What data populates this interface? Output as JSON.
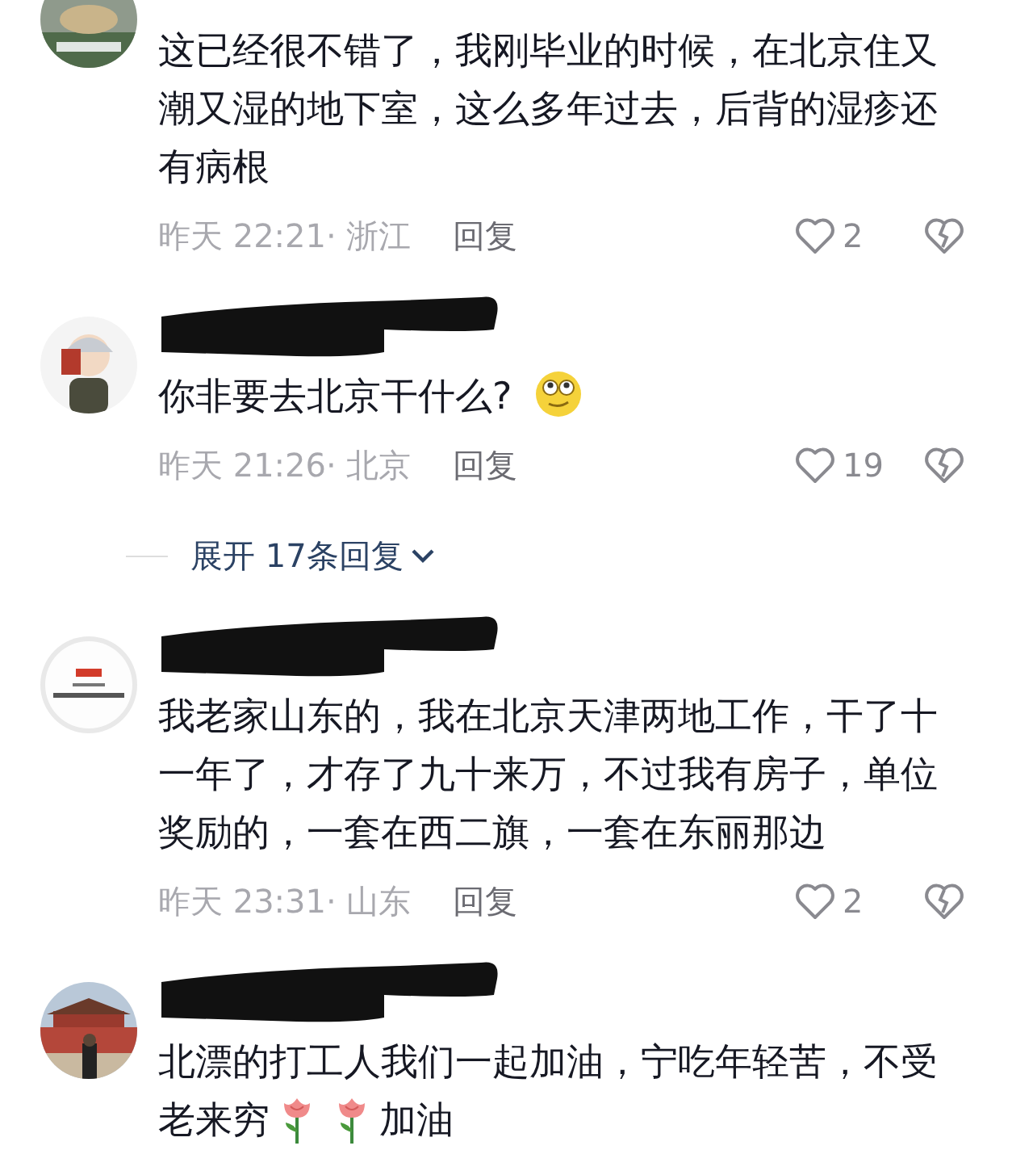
{
  "comments": [
    {
      "avatar": {
        "kind": "picture"
      },
      "redacted": false,
      "body": [
        {
          "kind": "text",
          "text": "这已经很不错了，我刚毕业的时候，在北京住又潮又湿的地下室，这么多年过去，后背的湿疹还有病根"
        }
      ],
      "meta": "昨天 22:21· 浙江",
      "reply": "回复",
      "likes": "2"
    },
    {
      "avatar": {
        "kind": "picture"
      },
      "redacted": true,
      "body": [
        {
          "kind": "text",
          "text": "你非要去北京干什么?"
        },
        {
          "kind": "emoji"
        }
      ],
      "meta": "昨天 21:26· 北京",
      "reply": "回复",
      "likes": "19",
      "replies_toggle": "展开 17条回复"
    },
    {
      "avatar": {
        "kind": "picture"
      },
      "redacted": true,
      "body": [
        {
          "kind": "text",
          "text": "我老家山东的，我在北京天津两地工作，干了十一年了，才存了九十来万，不过我有房子，单位奖励的，一套在西二旗，一套在东丽那边"
        }
      ],
      "meta": "昨天 23:31· 山东",
      "reply": "回复",
      "likes": "2"
    },
    {
      "avatar": {
        "kind": "picture"
      },
      "redacted": true,
      "body": [
        {
          "kind": "text",
          "text": "北漂的打工人我们一起加油，宁吃年轻苦，不受"
        },
        {
          "kind": "text",
          "text": "老来穷"
        },
        {
          "kind": "rose"
        },
        {
          "kind": "rose"
        },
        {
          "kind": "text",
          "text": "加油"
        }
      ]
    }
  ]
}
